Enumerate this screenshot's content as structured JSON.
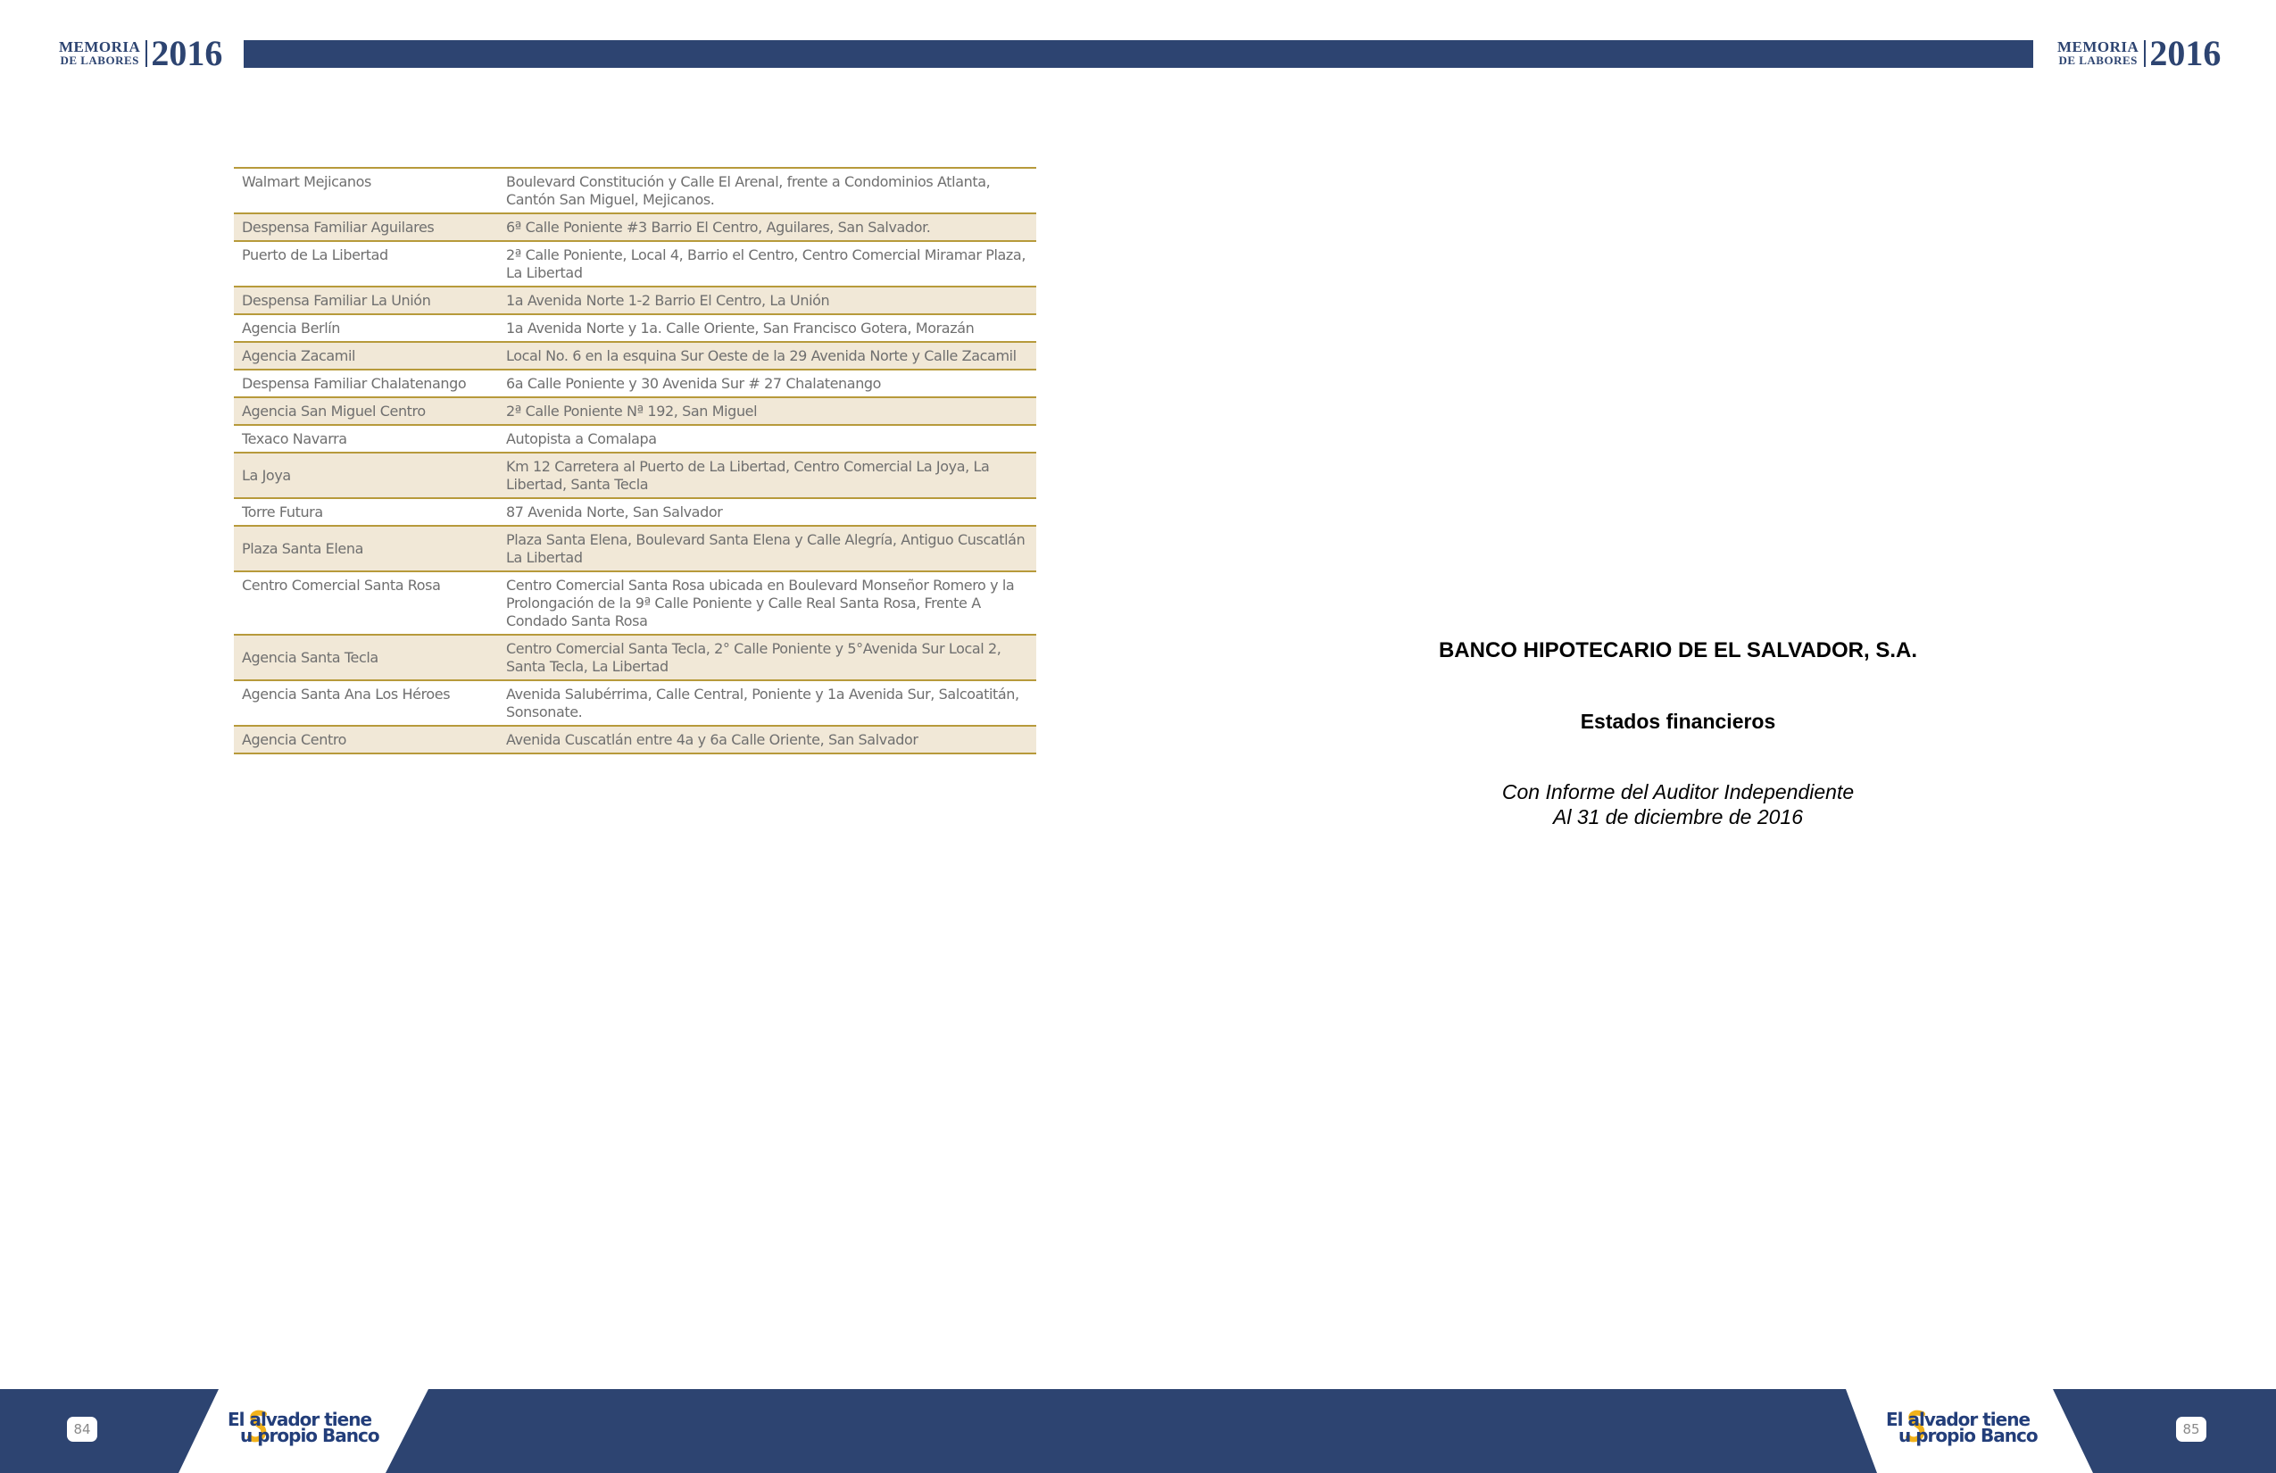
{
  "header": {
    "logo_line1": "MEMORIA",
    "logo_line2": "DE LABORES",
    "year": "2016"
  },
  "branches": [
    {
      "name": "Walmart Mejicanos",
      "address": "Boulevard Constitución  y Calle El Arenal, frente a Condominios Atlanta, Cantón San Miguel, Mejicanos."
    },
    {
      "name": "Despensa Familiar Aguilares",
      "address": "6ª Calle Poniente #3 Barrio El Centro, Aguilares, San Salvador."
    },
    {
      "name": "Puerto de La Libertad",
      "address": "2ª Calle Poniente, Local 4, Barrio el Centro, Centro Comercial Miramar Plaza, La Libertad"
    },
    {
      "name": "Despensa Familiar La Unión",
      "address": "1a Avenida Norte 1-2 Barrio El Centro, La Unión"
    },
    {
      "name": "Agencia Berlín",
      "address": "1a Avenida Norte y 1a. Calle Oriente, San Francisco Gotera, Morazán"
    },
    {
      "name": "Agencia Zacamil",
      "address": "Local No. 6 en la esquina Sur Oeste de la 29 Avenida Norte y Calle Zacamil"
    },
    {
      "name": "Despensa Familiar Chalatenango",
      "address": "6a Calle Poniente y 30 Avenida Sur # 27 Chalatenango"
    },
    {
      "name": "Agencia San Miguel Centro",
      "address": "2ª Calle Poniente Nª 192, San Miguel"
    },
    {
      "name": "Texaco Navarra",
      "address": "Autopista a Comalapa"
    },
    {
      "name": "La Joya",
      "address": "Km 12 Carretera al Puerto de La Libertad, Centro Comercial La Joya, La Libertad, Santa Tecla"
    },
    {
      "name": "Torre Futura",
      "address": "87 Avenida Norte, San Salvador"
    },
    {
      "name": "Plaza Santa Elena",
      "address": "Plaza Santa Elena, Boulevard Santa Elena y Calle Alegría,  Antiguo Cuscatlán La Libertad"
    },
    {
      "name": "Centro Comercial Santa Rosa",
      "address": "Centro Comercial Santa Rosa ubicada en Boulevard Monseñor Romero y la Prolongación de la 9ª Calle Poniente y Calle Real Santa Rosa, Frente A Condado Santa Rosa"
    },
    {
      "name": "Agencia Santa Tecla",
      "address": "Centro Comercial Santa Tecla, 2° Calle Poniente y 5°Avenida Sur Local 2, Santa Tecla, La Libertad"
    },
    {
      "name": "Agencia Santa Ana Los Héroes",
      "address": "Avenida Salubérrima, Calle Central, Poniente y 1a Avenida Sur, Salcoatitán, Sonsonate."
    },
    {
      "name": "Agencia Centro",
      "address": "Avenida Cuscatlán entre 4a y 6a Calle Oriente, San Salvador"
    }
  ],
  "right_page": {
    "bank_name": "BANCO HIPOTECARIO DE EL SALVADOR, S.A.",
    "subtitle": "Estados financieros",
    "auditor_line1": "Con Informe del Auditor Independiente",
    "auditor_line2": "Al 31 de diciembre de 2016"
  },
  "footer": {
    "page_left": "84",
    "page_right": "85",
    "slogan_line1": "El  alvador tiene",
    "slogan_line2": "u propio Banco"
  },
  "colors": {
    "navy": "#2d4471",
    "gold_rule": "#b79a3b",
    "row_shade": "#f1e8d7",
    "slogan_yellow": "#f2b21b"
  }
}
